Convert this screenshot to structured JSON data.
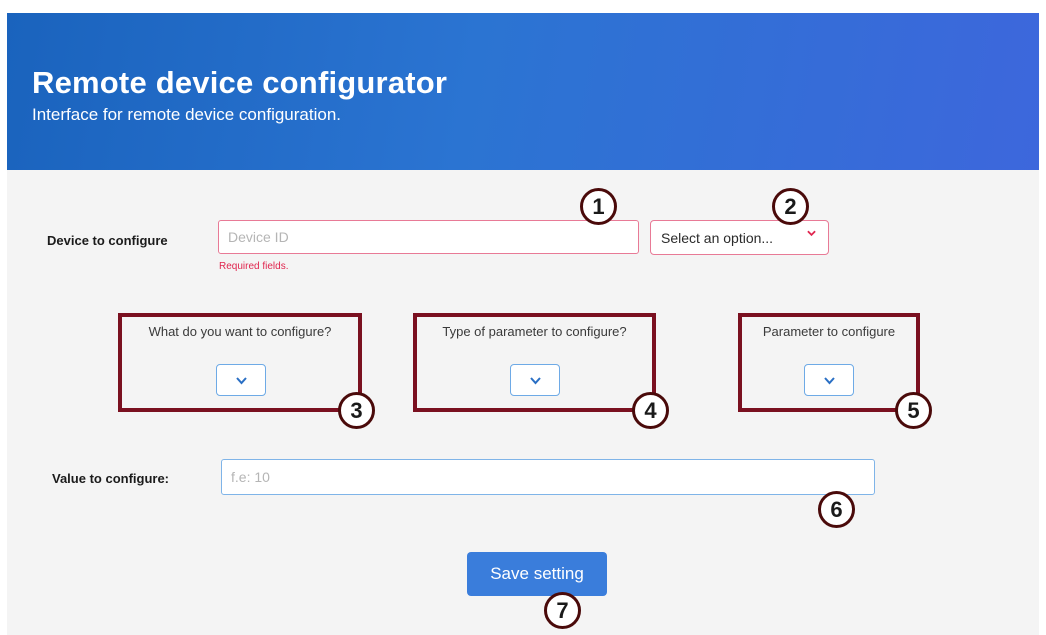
{
  "header": {
    "title": "Remote device configurator",
    "subtitle": "Interface for remote device configuration."
  },
  "device": {
    "label": "Device to configure",
    "input_placeholder": "Device ID",
    "error_text": "Required fields.",
    "select_value": "Select an option..."
  },
  "config_boxes": [
    {
      "label": "What do you want to configure?"
    },
    {
      "label": "Type of parameter to configure?"
    },
    {
      "label": "Parameter to configure"
    }
  ],
  "value": {
    "label": "Value to configure:",
    "placeholder": "f.e: 10"
  },
  "save_label": "Save setting",
  "badges": [
    "1",
    "2",
    "3",
    "4",
    "5",
    "6",
    "7"
  ],
  "colors": {
    "header_gradient_start": "#1a63bd",
    "header_gradient_end": "#3d67dc",
    "error": "#e0264f",
    "primary_button": "#3a7ddb",
    "annotation_frame": "#7a1020"
  },
  "icons": {
    "select_arrow": "chevron-down-icon",
    "dropdown_arrow": "chevron-down-icon"
  }
}
